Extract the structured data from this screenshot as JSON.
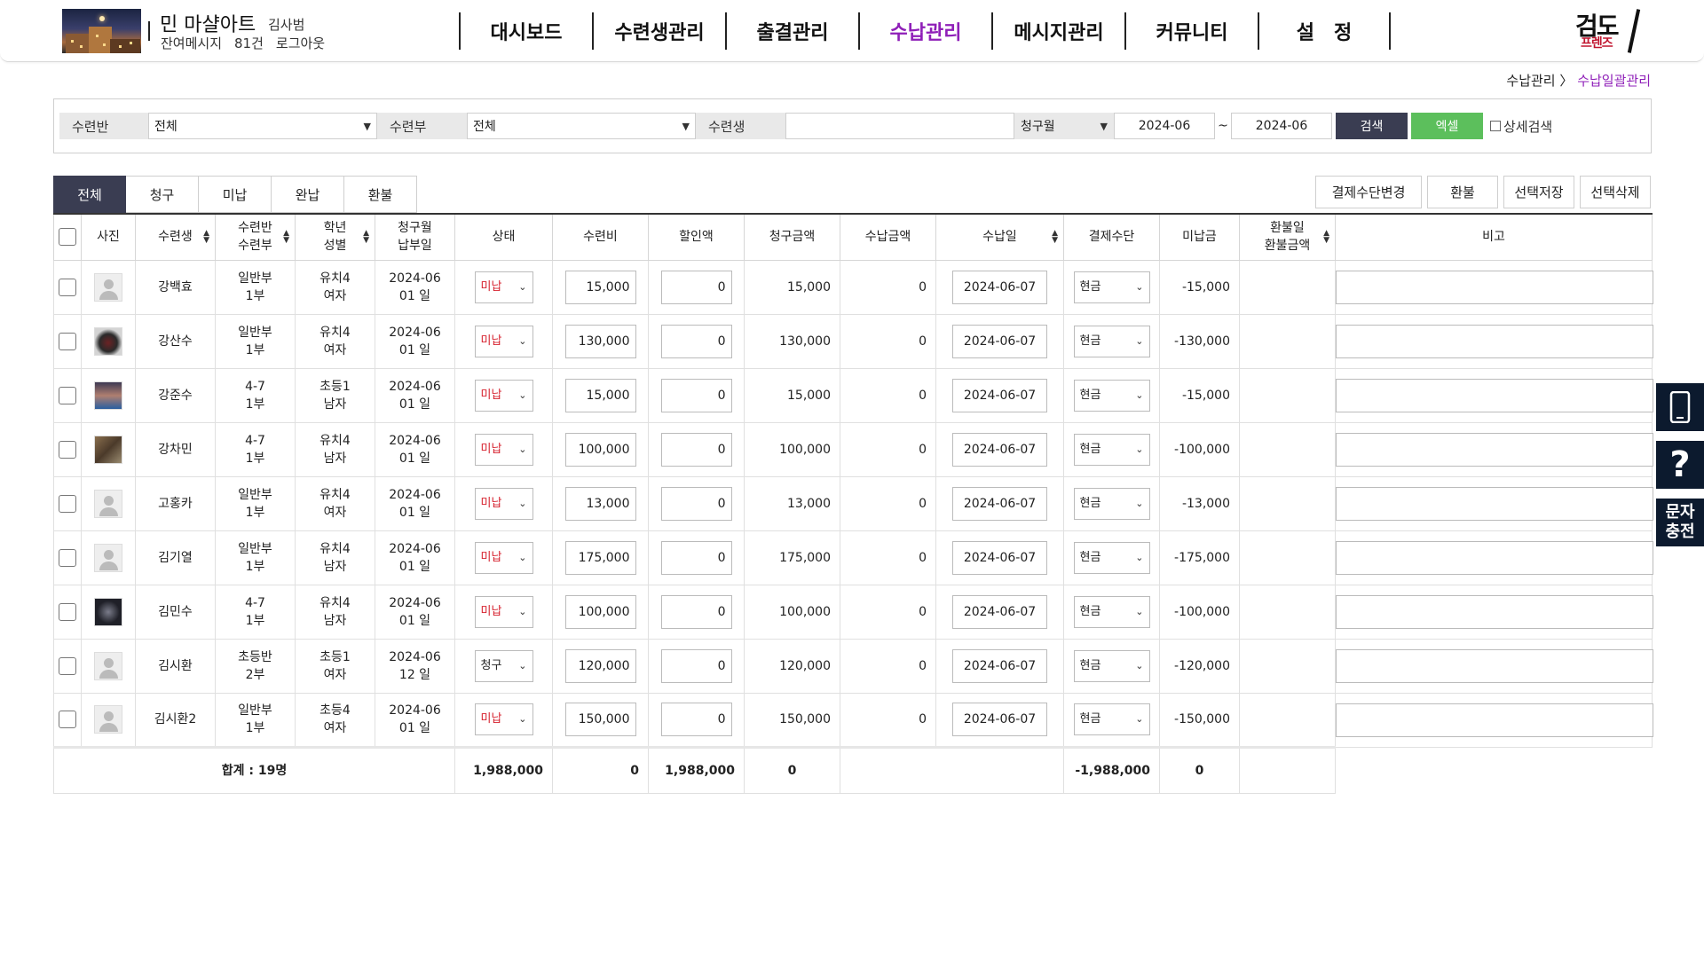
{
  "header": {
    "org_name": "민 마샬아트",
    "user_name": "김사범",
    "remaining_label": "잔여메시지",
    "remaining_count": "81건",
    "logout": "로그아웃",
    "brand_line1": "검도",
    "brand_line2": "프렌즈"
  },
  "nav": [
    "대시보드",
    "수련생관리",
    "출결관리",
    "수납관리",
    "메시지관리",
    "커뮤니티",
    "설　정"
  ],
  "breadcrumb": {
    "parent": "수납관리",
    "current": "수납일괄관리"
  },
  "search": {
    "class_label": "수련반",
    "class_value": "전체",
    "part_label": "수련부",
    "part_value": "전체",
    "student_label": "수련생",
    "month_label": "청구월",
    "month_from": "2024-06",
    "tilde": "~",
    "month_to": "2024-06",
    "search_btn": "검색",
    "excel_btn": "엑셀",
    "detail_label": "상세검색"
  },
  "tabs": [
    "전체",
    "청구",
    "미납",
    "완납",
    "환불"
  ],
  "actions": [
    "결제수단변경",
    "환불",
    "선택저장",
    "선택삭제"
  ],
  "columns": {
    "photo": "사진",
    "student": "수련생",
    "class1": "수련반",
    "class2": "수련부",
    "grade1": "학년",
    "grade2": "성별",
    "month1": "청구월",
    "month2": "납부일",
    "status": "상태",
    "fee": "수련비",
    "discount": "할인액",
    "billed": "청구금액",
    "paid": "수납금액",
    "paid_date": "수납일",
    "method": "결제수단",
    "unpaid": "미납금",
    "refund1": "환불일",
    "refund2": "환불금액",
    "note": "비고"
  },
  "rows": [
    {
      "name": "강백효",
      "class": "일반부",
      "part": "1부",
      "grade": "유치4",
      "gender": "여자",
      "month": "2024-06",
      "due": "01 일",
      "status": "미납",
      "fee": "15,000",
      "discount": "0",
      "billed": "15,000",
      "paid": "0",
      "date": "2024-06-07",
      "method": "현금",
      "unpaid": "-15,000",
      "photo": "default"
    },
    {
      "name": "강산수",
      "class": "일반부",
      "part": "1부",
      "grade": "유치4",
      "gender": "여자",
      "month": "2024-06",
      "due": "01 일",
      "status": "미납",
      "fee": "130,000",
      "discount": "0",
      "billed": "130,000",
      "paid": "0",
      "date": "2024-06-07",
      "method": "현금",
      "unpaid": "-130,000",
      "photo": "p1"
    },
    {
      "name": "강준수",
      "class": "4-7",
      "part": "1부",
      "grade": "초등1",
      "gender": "남자",
      "month": "2024-06",
      "due": "01 일",
      "status": "미납",
      "fee": "15,000",
      "discount": "0",
      "billed": "15,000",
      "paid": "0",
      "date": "2024-06-07",
      "method": "현금",
      "unpaid": "-15,000",
      "photo": "p2"
    },
    {
      "name": "강차민",
      "class": "4-7",
      "part": "1부",
      "grade": "유치4",
      "gender": "남자",
      "month": "2024-06",
      "due": "01 일",
      "status": "미납",
      "fee": "100,000",
      "discount": "0",
      "billed": "100,000",
      "paid": "0",
      "date": "2024-06-07",
      "method": "현금",
      "unpaid": "-100,000",
      "photo": "p3"
    },
    {
      "name": "고홍카",
      "class": "일반부",
      "part": "1부",
      "grade": "유치4",
      "gender": "여자",
      "month": "2024-06",
      "due": "01 일",
      "status": "미납",
      "fee": "13,000",
      "discount": "0",
      "billed": "13,000",
      "paid": "0",
      "date": "2024-06-07",
      "method": "현금",
      "unpaid": "-13,000",
      "photo": "default"
    },
    {
      "name": "김기열",
      "class": "일반부",
      "part": "1부",
      "grade": "유치4",
      "gender": "남자",
      "month": "2024-06",
      "due": "01 일",
      "status": "미납",
      "fee": "175,000",
      "discount": "0",
      "billed": "175,000",
      "paid": "0",
      "date": "2024-06-07",
      "method": "현금",
      "unpaid": "-175,000",
      "photo": "default"
    },
    {
      "name": "김민수",
      "class": "4-7",
      "part": "1부",
      "grade": "유치4",
      "gender": "남자",
      "month": "2024-06",
      "due": "01 일",
      "status": "미납",
      "fee": "100,000",
      "discount": "0",
      "billed": "100,000",
      "paid": "0",
      "date": "2024-06-07",
      "method": "현금",
      "unpaid": "-100,000",
      "photo": "p4"
    },
    {
      "name": "김시환",
      "class": "초등반",
      "part": "2부",
      "grade": "초등1",
      "gender": "여자",
      "month": "2024-06",
      "due": "12 일",
      "status": "청구",
      "fee": "120,000",
      "discount": "0",
      "billed": "120,000",
      "paid": "0",
      "date": "2024-06-07",
      "method": "현금",
      "unpaid": "-120,000",
      "photo": "default"
    },
    {
      "name": "김시환2",
      "class": "일반부",
      "part": "1부",
      "grade": "초등4",
      "gender": "여자",
      "month": "2024-06",
      "due": "01 일",
      "status": "미납",
      "fee": "150,000",
      "discount": "0",
      "billed": "150,000",
      "paid": "0",
      "date": "2024-06-07",
      "method": "현금",
      "unpaid": "-150,000",
      "photo": "default"
    }
  ],
  "summary": {
    "label": "합계 : 19명",
    "fee": "1,988,000",
    "discount": "0",
    "billed": "1,988,000",
    "paid": "0",
    "unpaid": "-1,988,000",
    "refund": "0"
  },
  "side": {
    "charge_line1": "문자",
    "charge_line2": "충전",
    "help": "?"
  },
  "colors": {
    "accent": "#8f1fb8",
    "dark_button": "#3a3d52",
    "excel": "#5cbf5c",
    "side": "#0c1a2e"
  }
}
